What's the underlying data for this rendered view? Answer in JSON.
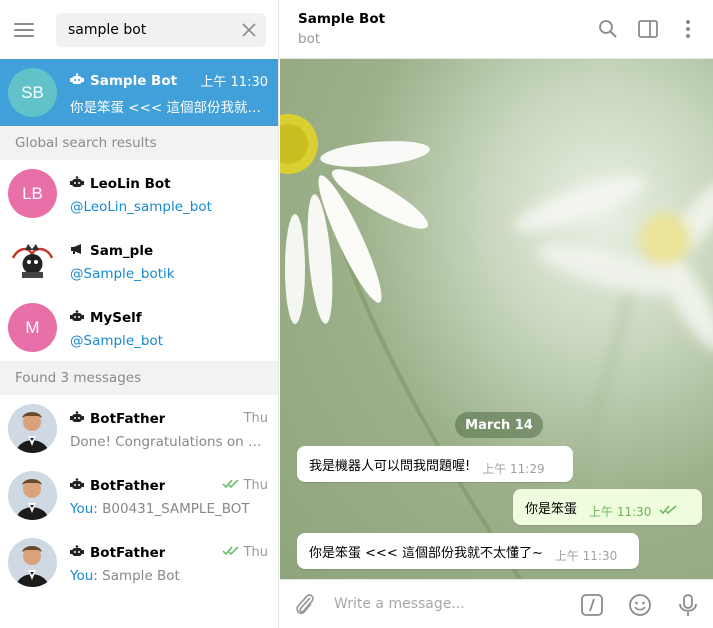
{
  "search": {
    "value": "sample bot"
  },
  "results": [
    {
      "initials": "SB",
      "name": "Sample Bot",
      "time": "上午 11:30",
      "sub": "你是笨蛋 <<< 這個部份我就不...",
      "color": "#61c3c9",
      "active": true,
      "icon": "bot-icon"
    }
  ],
  "global_label": "Global search results",
  "global": [
    {
      "initials": "LB",
      "name": "LeoLin Bot",
      "sub": "@LeoLin_sample_bot",
      "color": "#e86fa8",
      "icon": "bot-icon"
    },
    {
      "initials": "",
      "name": "Sam_ple",
      "sub": "@Sample_botik",
      "color": "#ffffff",
      "icon": "megaphone-icon"
    },
    {
      "initials": "M",
      "name": "MySelf",
      "sub": "@Sample_bot",
      "color": "#e86fa8",
      "icon": "bot-icon"
    }
  ],
  "found_label": "Found 3 messages",
  "messages": [
    {
      "name": "BotFather",
      "time": "Thu",
      "you": "",
      "sub": "Done! Congratulations on yo...",
      "checks": false
    },
    {
      "name": "BotFather",
      "time": "Thu",
      "you": "You:",
      "sub": "B00431_SAMPLE_BOT",
      "checks": true
    },
    {
      "name": "BotFather",
      "time": "Thu",
      "you": "You:",
      "sub": "Sample Bot",
      "checks": true
    }
  ],
  "chat": {
    "title": "Sample Bot",
    "subtitle": "bot",
    "date": "March 14",
    "bubbles": [
      {
        "dir": "in",
        "text": "我是機器人可以問我問題喔!",
        "time": "上午 11:29"
      },
      {
        "dir": "out",
        "text": "你是笨蛋",
        "time": "上午 11:30"
      },
      {
        "dir": "in",
        "text": "你是笨蛋 <<< 這個部份我就不太懂了~",
        "time": "上午 11:30"
      }
    ],
    "composer_placeholder": "Write a message..."
  },
  "colors": {
    "accent": "#419fd9",
    "link": "#168acd",
    "out_bubble": "#effdde"
  }
}
